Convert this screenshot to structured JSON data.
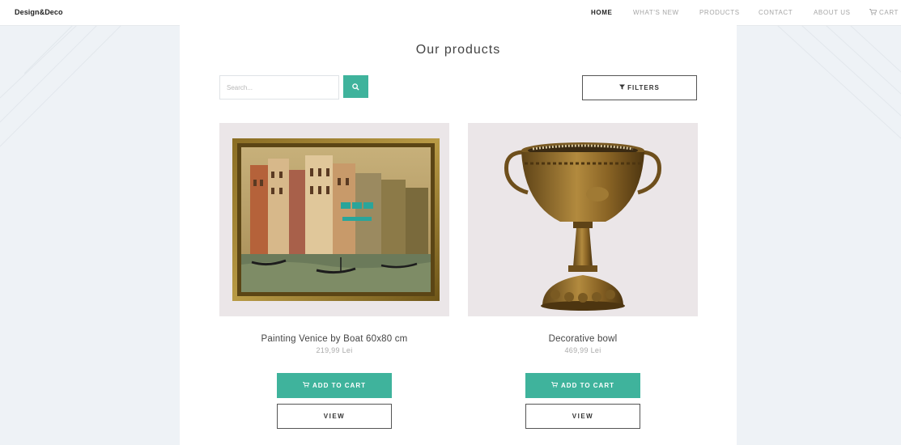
{
  "header": {
    "brand": "Design&Deco",
    "nav": [
      {
        "label": "HOME",
        "active": true
      },
      {
        "label": "WHAT'S NEW",
        "active": false
      },
      {
        "label": "PRODUCTS",
        "active": false
      },
      {
        "label": "CONTACT",
        "active": false
      },
      {
        "label": "ABOUT US",
        "active": false
      },
      {
        "label": "CART",
        "active": false,
        "icon": "cart-icon"
      }
    ]
  },
  "main": {
    "title": "Our products",
    "search": {
      "placeholder": "Search...",
      "value": "",
      "button_icon": "search-icon"
    },
    "filters": {
      "label": "FILTERS",
      "icon": "filter-icon"
    }
  },
  "products": [
    {
      "name": "Painting Venice by Boat 60x80 cm",
      "price": "219,99 Lei",
      "image": "framed-venice-painting",
      "add_label": "ADD TO CART",
      "view_label": "VIEW"
    },
    {
      "name": "Decorative bowl",
      "price": "469,99 Lei",
      "image": "bronze-decorative-bowl",
      "add_label": "ADD TO CART",
      "view_label": "VIEW"
    }
  ],
  "colors": {
    "accent": "#3fb39c",
    "background": "#eef2f6",
    "panel": "#ffffff",
    "image_bg": "#ebe6e8"
  }
}
